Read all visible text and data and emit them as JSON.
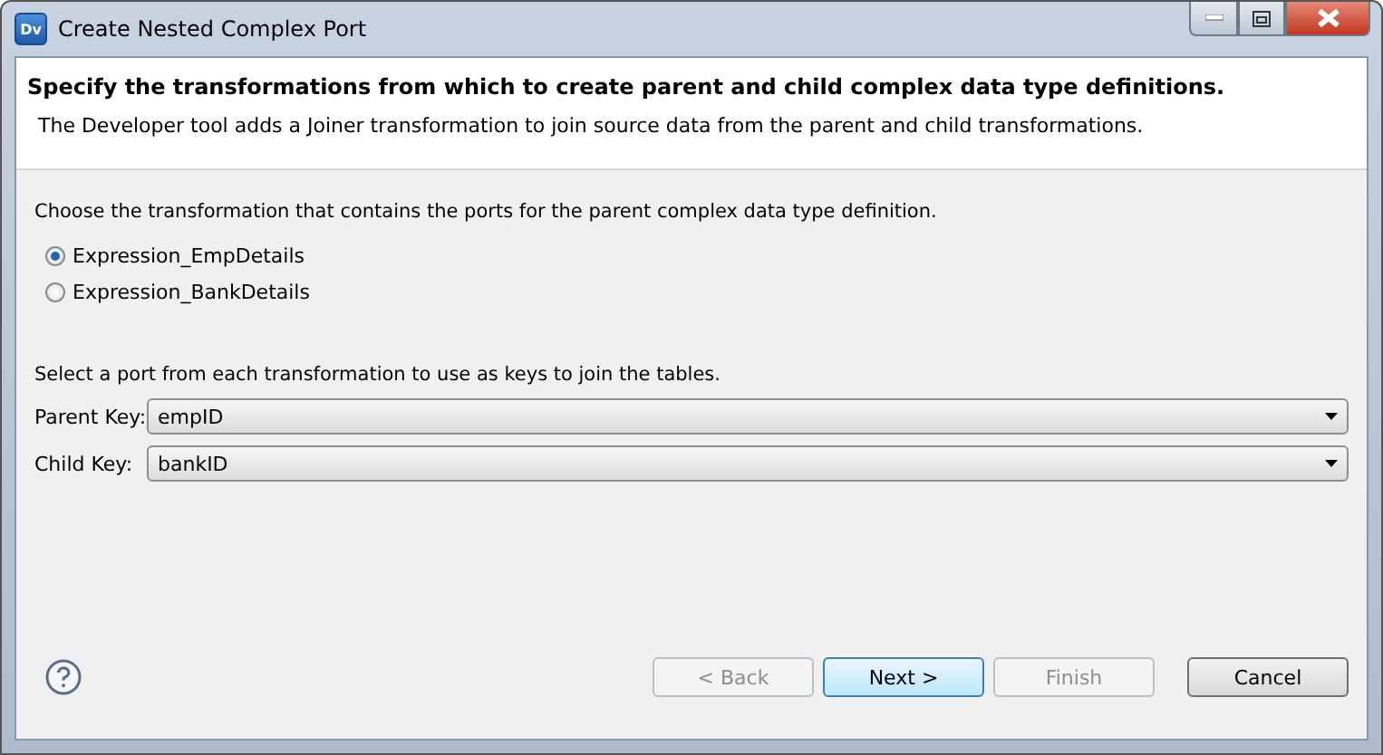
{
  "window": {
    "title": "Create Nested Complex Port",
    "icon_text": "Dv"
  },
  "header": {
    "title": "Specify the transformations from which to create parent and child complex data type definitions.",
    "description": "The Developer tool adds a Joiner transformation to join source data from the parent and child transformations."
  },
  "parent_choice": {
    "prompt": "Choose the transformation that contains the ports for the parent complex data type definition.",
    "options": [
      {
        "label": "Expression_EmpDetails",
        "selected": true
      },
      {
        "label": "Expression_BankDetails",
        "selected": false
      }
    ]
  },
  "keys": {
    "prompt": "Select a port from each transformation to use as keys to join the tables.",
    "fields": [
      {
        "label": "Parent Key:",
        "value": "empID"
      },
      {
        "label": "Child Key:",
        "value": "bankID"
      }
    ]
  },
  "buttons": [
    {
      "label": "< Back",
      "disabled": true,
      "default": false
    },
    {
      "label": "Next >",
      "disabled": false,
      "default": true
    },
    {
      "label": "Finish",
      "disabled": true,
      "default": false
    },
    {
      "label": "Cancel",
      "disabled": false,
      "default": false
    }
  ]
}
